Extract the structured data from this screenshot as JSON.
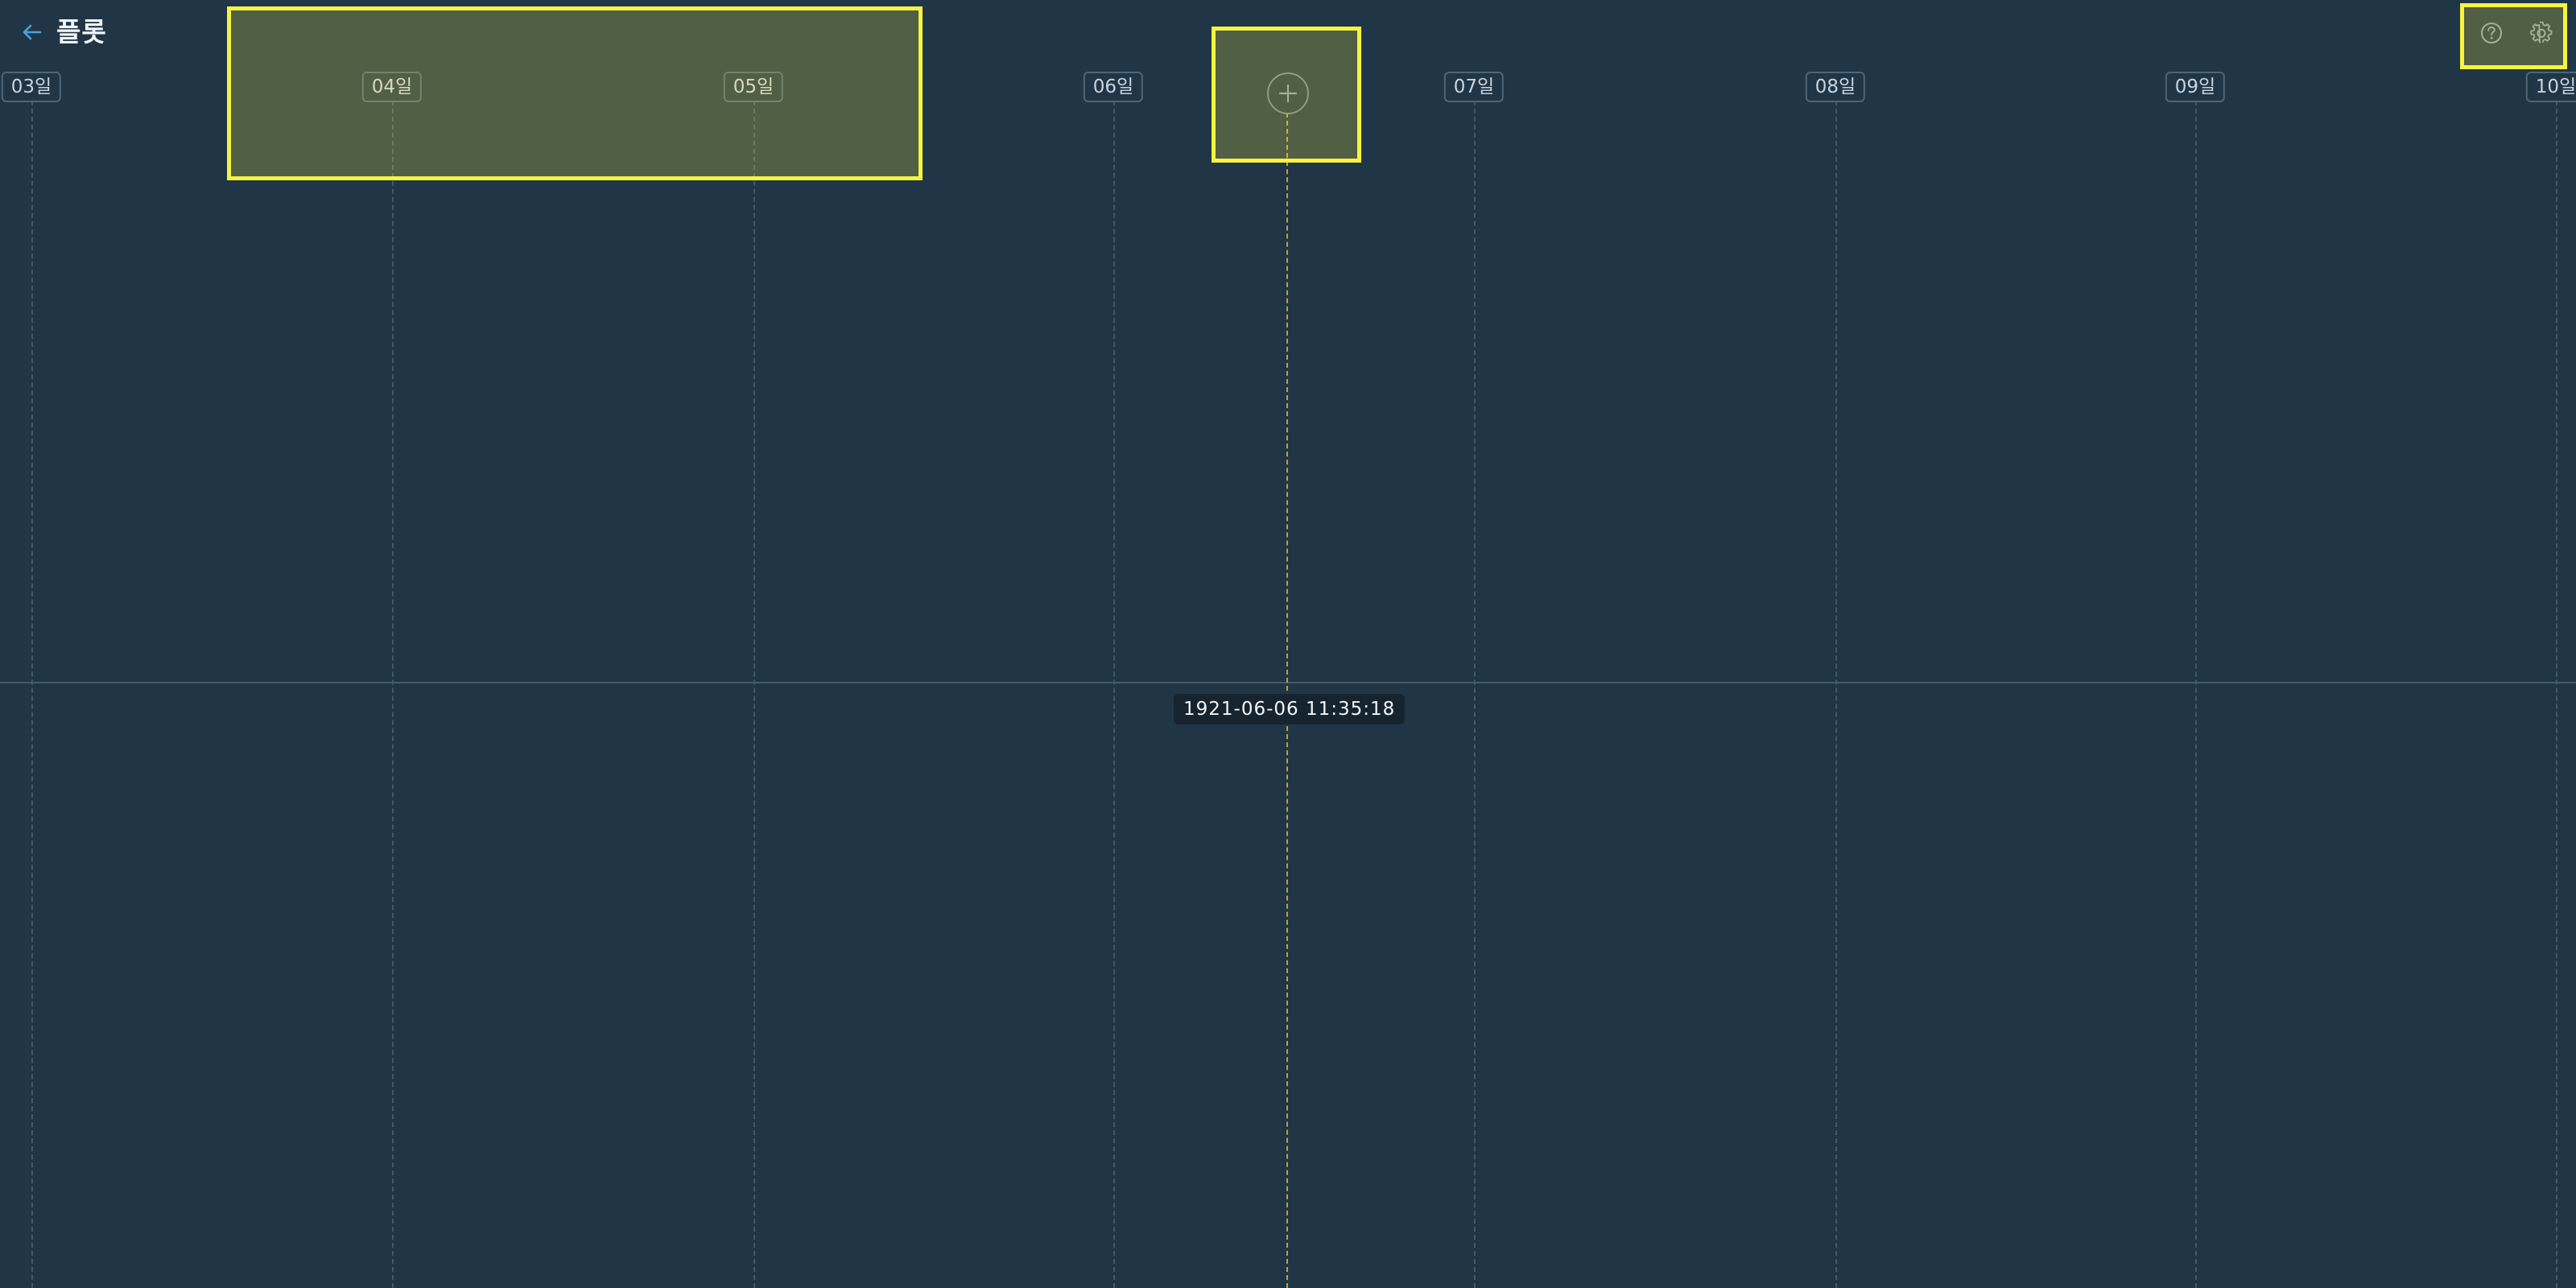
{
  "header": {
    "title": "플롯",
    "back_icon": "arrow-left-icon"
  },
  "toolbar": {
    "help_icon": "help-circle-icon",
    "settings_icon": "gear-icon"
  },
  "timeline": {
    "days": [
      {
        "label": "03일"
      },
      {
        "label": "04일"
      },
      {
        "label": "05일"
      },
      {
        "label": "06일"
      },
      {
        "label": "07일"
      },
      {
        "label": "08일"
      },
      {
        "label": "09일"
      },
      {
        "label": "10일"
      }
    ],
    "cursor_time": "1921-06-06 11:35:18",
    "add_icon": "plus-icon"
  },
  "colors": {
    "background": "#203647",
    "cursor": "#c9a227",
    "highlight": "#f7f33e",
    "accent": "#4aa3df"
  }
}
